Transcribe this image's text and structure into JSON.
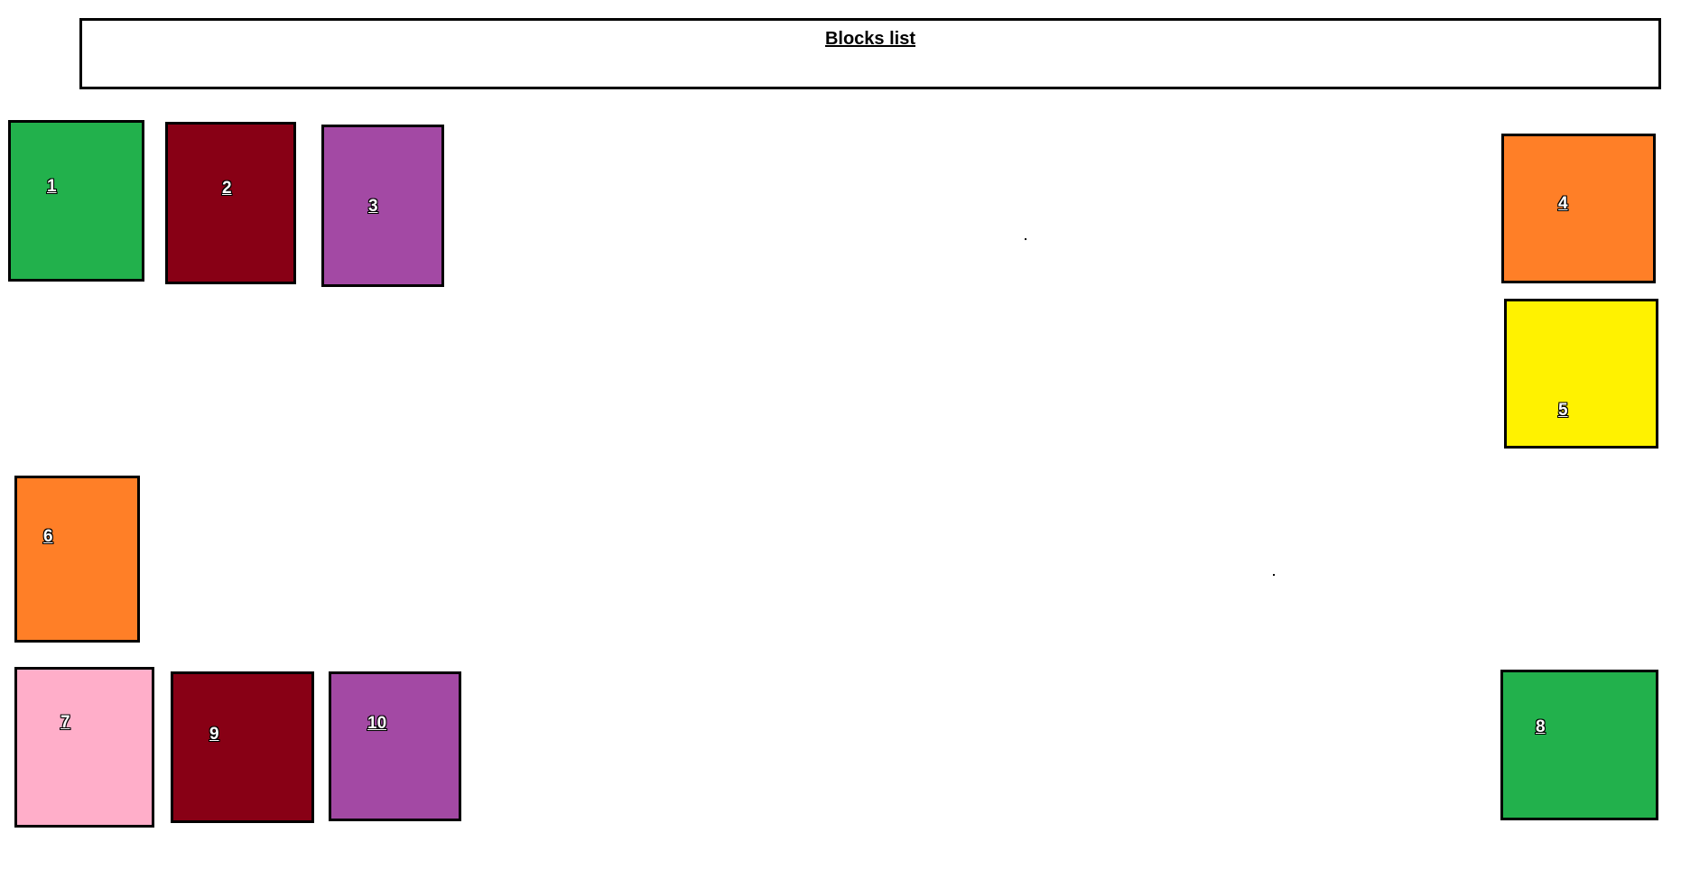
{
  "title": "Blocks list",
  "blocks": [
    {
      "id": "b1",
      "label": "1",
      "color": "#22b14c"
    },
    {
      "id": "b2",
      "label": "2",
      "color": "#880015"
    },
    {
      "id": "b3",
      "label": "3",
      "color": "#a349a4"
    },
    {
      "id": "b4",
      "label": "4",
      "color": "#ff7f27"
    },
    {
      "id": "b5",
      "label": "5",
      "color": "#fff200"
    },
    {
      "id": "b6",
      "label": "6",
      "color": "#ff7f27"
    },
    {
      "id": "b7",
      "label": "7",
      "color": "#ffaec9"
    },
    {
      "id": "b9",
      "label": "9",
      "color": "#880015"
    },
    {
      "id": "b10",
      "label": "10",
      "color": "#a349a4"
    },
    {
      "id": "b8",
      "label": "8",
      "color": "#22b14c"
    }
  ]
}
